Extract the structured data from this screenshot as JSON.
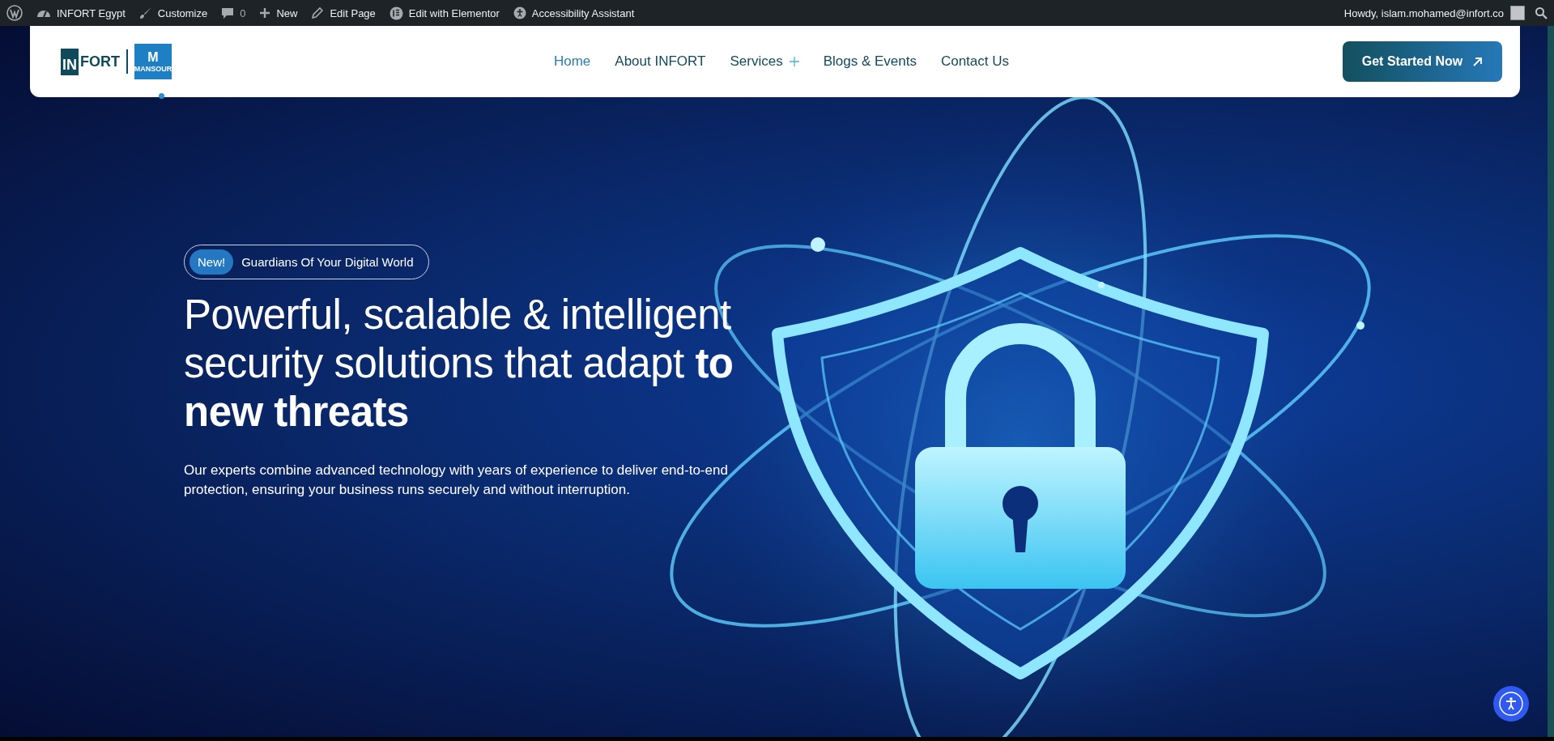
{
  "admin_bar": {
    "items": [
      {
        "kind": "wordpress"
      },
      {
        "kind": "dashboard",
        "label": "INFORT Egypt"
      },
      {
        "kind": "brush",
        "label": "Customize"
      },
      {
        "kind": "comment",
        "label": "0"
      },
      {
        "kind": "plus",
        "label": "New"
      },
      {
        "kind": "pencil",
        "label": "Edit Page"
      },
      {
        "kind": "elementor",
        "label": "Edit with Elementor"
      },
      {
        "kind": "accessibility",
        "label": "Accessibility Assistant"
      }
    ],
    "greeting": "Howdy, islam.mohamed@infort.co"
  },
  "header": {
    "logo": {
      "part_1": "IN",
      "part_2": "FORT",
      "partner_mark": "M",
      "partner_name": "MANSOUR"
    },
    "nav": [
      {
        "label": "Home",
        "selected": true,
        "has_submenu": false
      },
      {
        "label": "About INFORT",
        "selected": false,
        "has_submenu": false
      },
      {
        "label": "Services",
        "selected": false,
        "has_submenu": true
      },
      {
        "label": "Blogs & Events",
        "selected": false,
        "has_submenu": false
      },
      {
        "label": "Contact Us",
        "selected": false,
        "has_submenu": false
      }
    ],
    "cta": "Get Started Now"
  },
  "hero": {
    "badge": "New!",
    "tagline": "Guardians Of Your Digital World",
    "headline": "Powerful, scalable & intelligent security solutions that adapt **to new threats**",
    "description": "Our experts combine advanced technology with years of experience to deliver end-to-end protection, ensuring your business runs securely and without interruption."
  }
}
